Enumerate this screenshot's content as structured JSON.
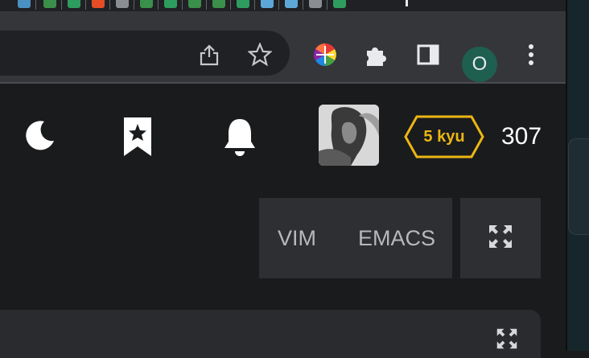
{
  "browser": {
    "tabs": [
      {
        "icon": "page-icon",
        "color": "#4a90c2"
      },
      {
        "icon": "codewars-icon",
        "color": "#3a8f4a"
      },
      {
        "icon": "db-icon",
        "color": "#2e9c5e"
      },
      {
        "icon": "html-icon",
        "color": "#e44d26"
      },
      {
        "icon": "e-icon",
        "color": "#8a8d91"
      },
      {
        "icon": "codewars-icon",
        "color": "#3a8f4a"
      },
      {
        "icon": "db-icon",
        "color": "#2e9c5e"
      },
      {
        "icon": "codewars-icon",
        "color": "#3a8f4a"
      },
      {
        "icon": "codewars-icon",
        "color": "#3a8f4a"
      },
      {
        "icon": "db-icon",
        "color": "#2e9c5e"
      },
      {
        "icon": "infinity-icon",
        "color": "#5da8d8"
      },
      {
        "icon": "infinity-icon",
        "color": "#5da8d8"
      },
      {
        "icon": "e-icon",
        "color": "#8a8d91"
      },
      {
        "icon": "db-icon",
        "color": "#2e9c5e"
      }
    ],
    "profile_initial": "O"
  },
  "header": {
    "rank_label": "5 kyu",
    "honor": "307"
  },
  "editor": {
    "modes": {
      "vim": "VIM",
      "emacs": "EMACS"
    }
  },
  "colors": {
    "rank": "#ecb613",
    "profile": "#1e5f50",
    "page_bg": "#1a1b1d"
  }
}
